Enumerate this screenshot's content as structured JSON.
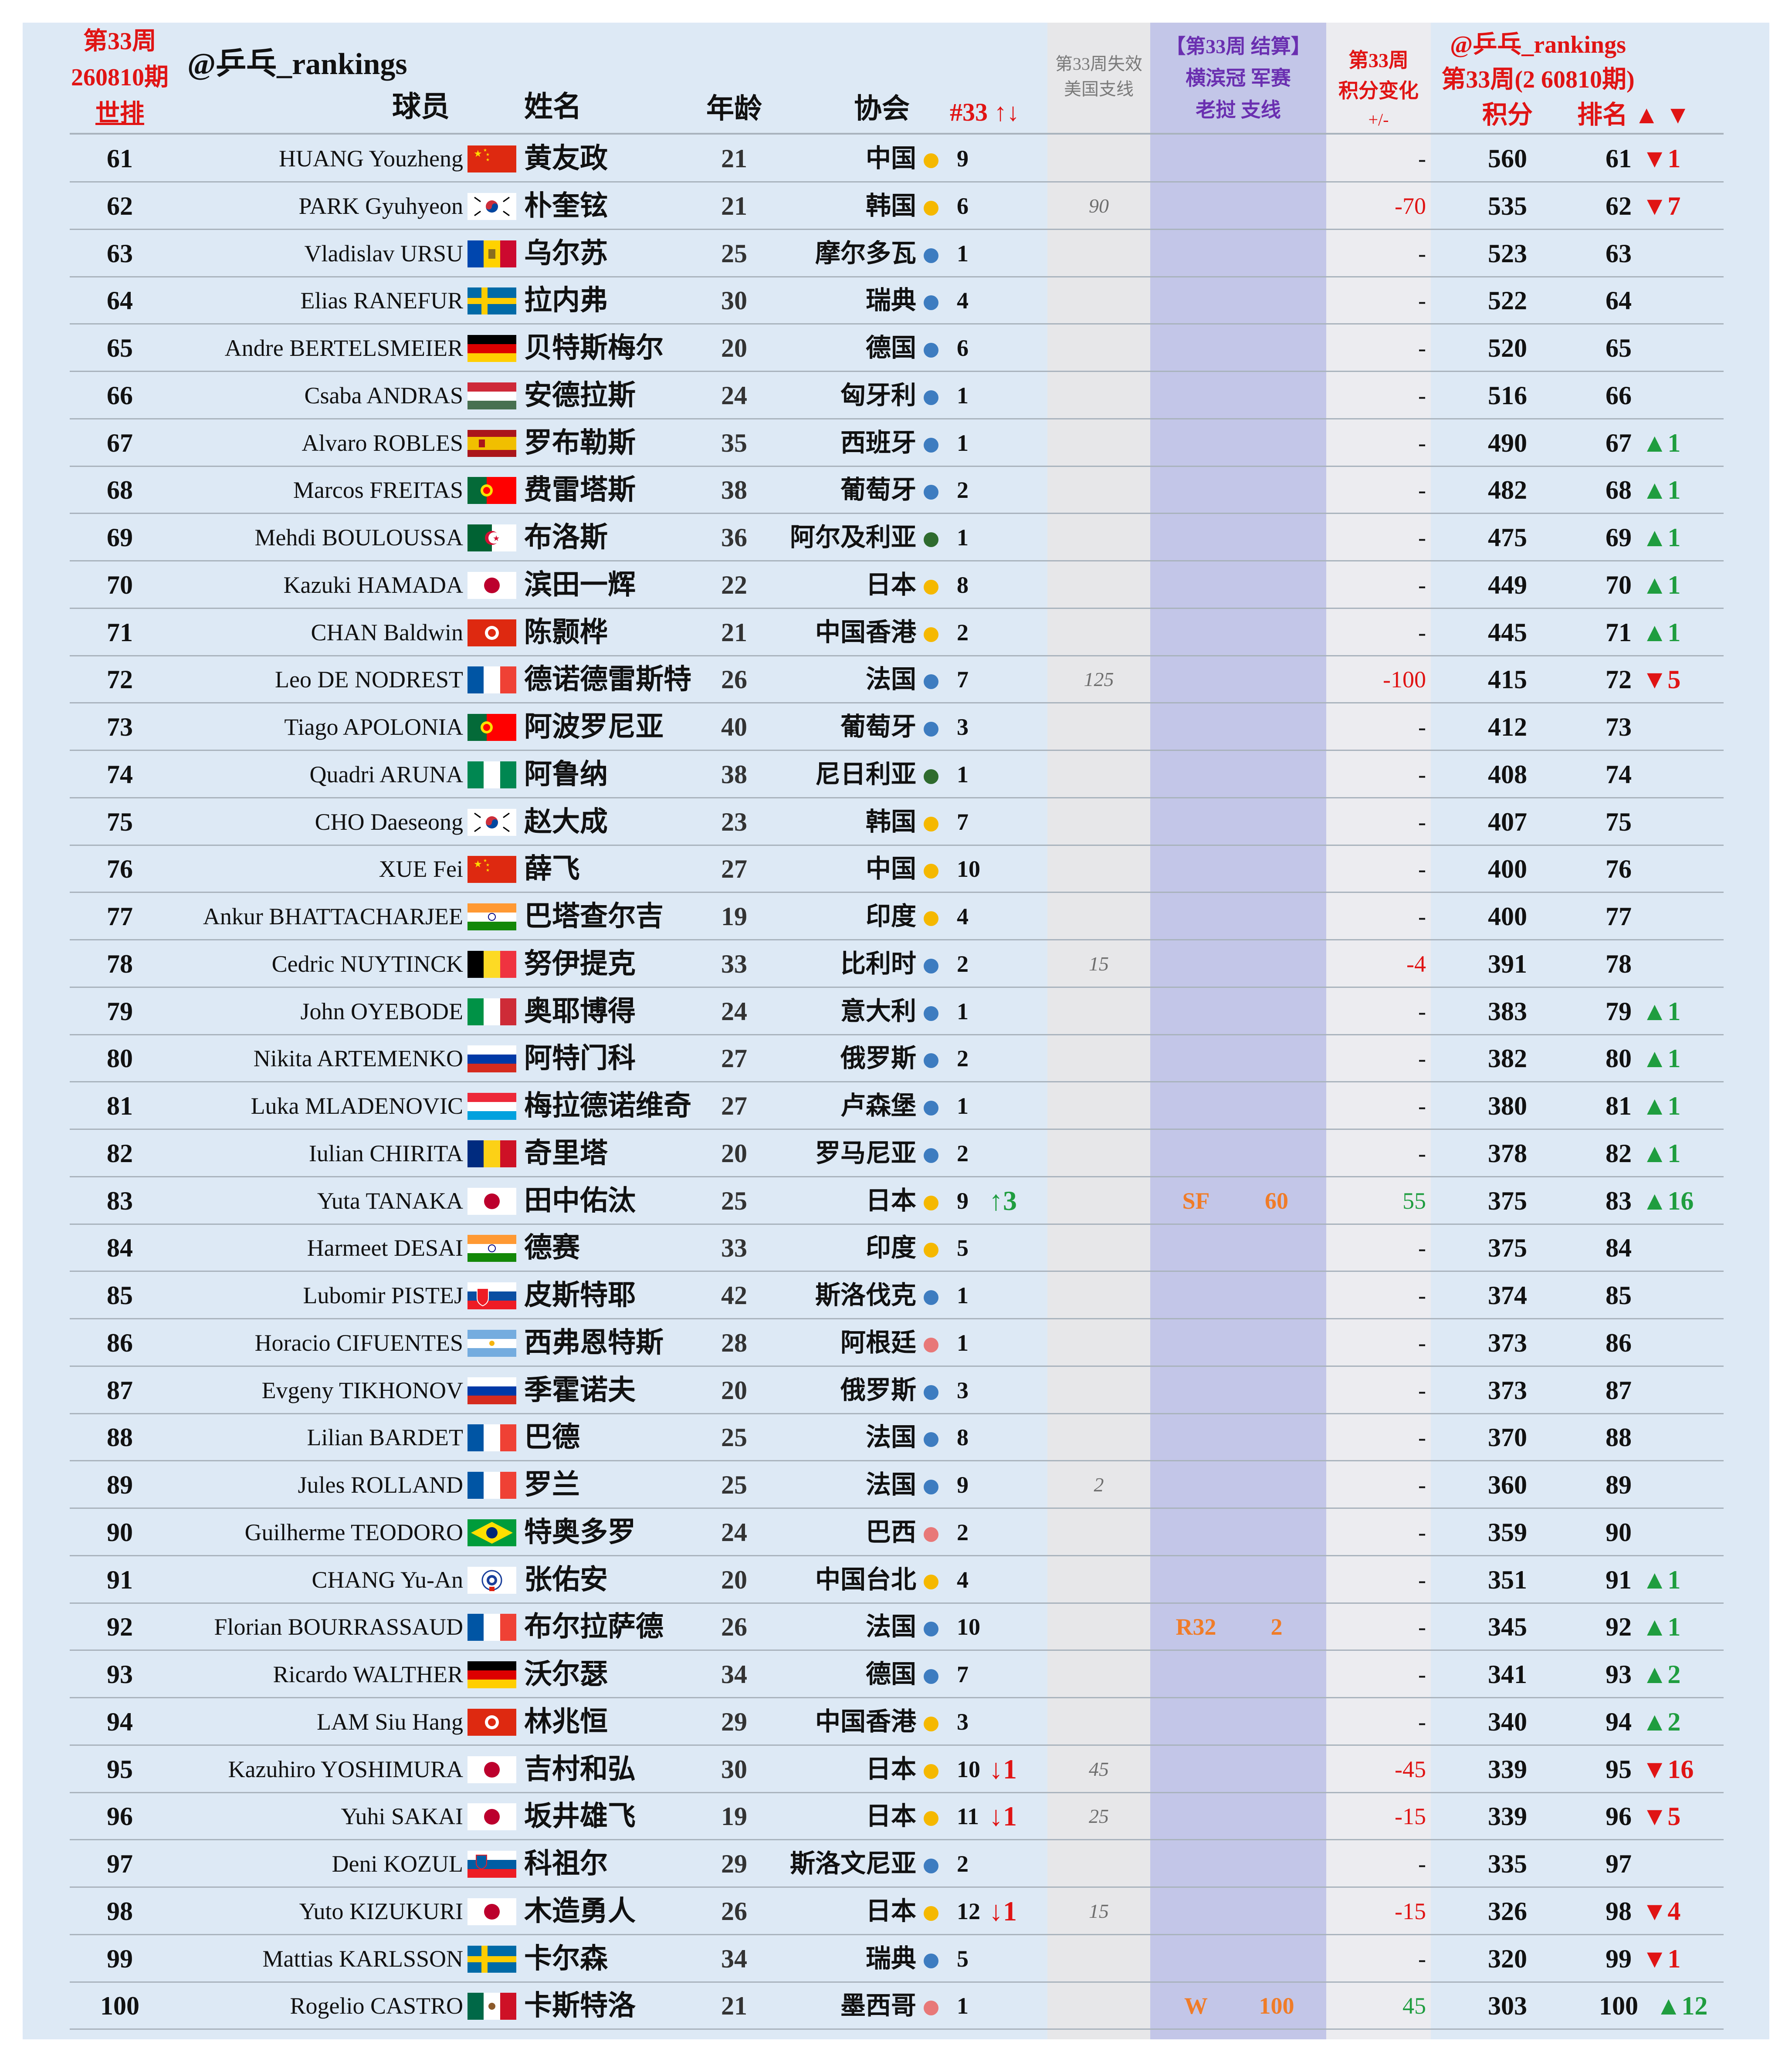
{
  "header": {
    "week_label": "第33周",
    "issue": "260810期",
    "world_rank_label": "世排",
    "brand": "@乒乓_rankings",
    "col_player": "球员",
    "col_name": "姓名",
    "col_age": "年龄",
    "col_assoc": "协会",
    "col_week_move": "#33 ↑↓",
    "loss_title_1": "第33周失效",
    "loss_title_2": "美国支线",
    "event_title_1": "【第33周 结算】",
    "event_title_2": "横滨冠 军赛",
    "event_title_3": "老挝 支线",
    "change_title_1": "第33周",
    "change_title_2": "积分变化",
    "change_title_3": "+/-",
    "brand_right": "@乒乓_rankings",
    "issue_right": "第33周(2 60810期)",
    "col_points": "积分",
    "col_rank": "排名 ▲ ▼"
  },
  "colors": {
    "frame_bg": "#dde9f5",
    "loss_band": "#e7e7e9",
    "event_band": "#c3c6e8",
    "title_red": "#e01414",
    "title_purple": "#6a2fb0",
    "up_green": "#1f9d3f",
    "down_red": "#e01414",
    "event_orange": "#f07c28",
    "dot_yellow": "#f5b800",
    "dot_blue": "#3d7cc0",
    "dot_green": "#2e6b2e",
    "dot_pink": "#e87878"
  },
  "rows": [
    {
      "rank": "61",
      "en": "HUANG Youzheng",
      "flag": "china",
      "cn": "黄友政",
      "age": "21",
      "assoc": "中国",
      "dot": "yellow",
      "count": "9",
      "move": "",
      "loss": "",
      "res": "",
      "epts": "",
      "chg": "-",
      "pts": "560",
      "new_rank": "61",
      "rmove": "▼1"
    },
    {
      "rank": "62",
      "en": "PARK Gyuhyeon",
      "flag": "korea",
      "cn": "朴奎铉",
      "age": "21",
      "assoc": "韩国",
      "dot": "yellow",
      "count": "6",
      "move": "",
      "loss": "90",
      "res": "",
      "epts": "",
      "chg": "-70",
      "pts": "535",
      "new_rank": "62",
      "rmove": "▼7"
    },
    {
      "rank": "63",
      "en": "Vladislav URSU",
      "flag": "moldova",
      "cn": "乌尔苏",
      "age": "25",
      "assoc": "摩尔多瓦",
      "dot": "blue",
      "count": "1",
      "move": "",
      "loss": "",
      "res": "",
      "epts": "",
      "chg": "-",
      "pts": "523",
      "new_rank": "63",
      "rmove": ""
    },
    {
      "rank": "64",
      "en": "Elias RANEFUR",
      "flag": "sweden",
      "cn": "拉内弗",
      "age": "30",
      "assoc": "瑞典",
      "dot": "blue",
      "count": "4",
      "move": "",
      "loss": "",
      "res": "",
      "epts": "",
      "chg": "-",
      "pts": "522",
      "new_rank": "64",
      "rmove": ""
    },
    {
      "rank": "65",
      "en": "Andre BERTELSMEIER",
      "flag": "germany",
      "cn": "贝特斯梅尔",
      "age": "20",
      "assoc": "德国",
      "dot": "blue",
      "count": "6",
      "move": "",
      "loss": "",
      "res": "",
      "epts": "",
      "chg": "-",
      "pts": "520",
      "new_rank": "65",
      "rmove": ""
    },
    {
      "rank": "66",
      "en": "Csaba ANDRAS",
      "flag": "hungary",
      "cn": "安德拉斯",
      "age": "24",
      "assoc": "匈牙利",
      "dot": "blue",
      "count": "1",
      "move": "",
      "loss": "",
      "res": "",
      "epts": "",
      "chg": "-",
      "pts": "516",
      "new_rank": "66",
      "rmove": ""
    },
    {
      "rank": "67",
      "en": "Alvaro ROBLES",
      "flag": "spain",
      "cn": "罗布勒斯",
      "age": "35",
      "assoc": "西班牙",
      "dot": "blue",
      "count": "1",
      "move": "",
      "loss": "",
      "res": "",
      "epts": "",
      "chg": "-",
      "pts": "490",
      "new_rank": "67",
      "rmove": "▲1"
    },
    {
      "rank": "68",
      "en": "Marcos FREITAS",
      "flag": "portugal",
      "cn": "费雷塔斯",
      "age": "38",
      "assoc": "葡萄牙",
      "dot": "blue",
      "count": "2",
      "move": "",
      "loss": "",
      "res": "",
      "epts": "",
      "chg": "-",
      "pts": "482",
      "new_rank": "68",
      "rmove": "▲1"
    },
    {
      "rank": "69",
      "en": "Mehdi BOULOUSSA",
      "flag": "algeria",
      "cn": "布洛斯",
      "age": "36",
      "assoc": "阿尔及利亚",
      "dot": "green",
      "count": "1",
      "move": "",
      "loss": "",
      "res": "",
      "epts": "",
      "chg": "-",
      "pts": "475",
      "new_rank": "69",
      "rmove": "▲1"
    },
    {
      "rank": "70",
      "en": "Kazuki HAMADA",
      "flag": "japan",
      "cn": "滨田一辉",
      "age": "22",
      "assoc": "日本",
      "dot": "yellow",
      "count": "8",
      "move": "",
      "loss": "",
      "res": "",
      "epts": "",
      "chg": "-",
      "pts": "449",
      "new_rank": "70",
      "rmove": "▲1"
    },
    {
      "rank": "71",
      "en": "CHAN Baldwin",
      "flag": "hongkong",
      "cn": "陈颢桦",
      "age": "21",
      "assoc": "中国香港",
      "dot": "yellow",
      "count": "2",
      "move": "",
      "loss": "",
      "res": "",
      "epts": "",
      "chg": "-",
      "pts": "445",
      "new_rank": "71",
      "rmove": "▲1"
    },
    {
      "rank": "72",
      "en": "Leo DE NODREST",
      "flag": "france",
      "cn": "德诺德雷斯特",
      "age": "26",
      "assoc": "法国",
      "dot": "blue",
      "count": "7",
      "move": "",
      "loss": "125",
      "res": "",
      "epts": "",
      "chg": "-100",
      "pts": "415",
      "new_rank": "72",
      "rmove": "▼5"
    },
    {
      "rank": "73",
      "en": "Tiago APOLONIA",
      "flag": "portugal",
      "cn": "阿波罗尼亚",
      "age": "40",
      "assoc": "葡萄牙",
      "dot": "blue",
      "count": "3",
      "move": "",
      "loss": "",
      "res": "",
      "epts": "",
      "chg": "-",
      "pts": "412",
      "new_rank": "73",
      "rmove": ""
    },
    {
      "rank": "74",
      "en": "Quadri ARUNA",
      "flag": "nigeria",
      "cn": "阿鲁纳",
      "age": "38",
      "assoc": "尼日利亚",
      "dot": "green",
      "count": "1",
      "move": "",
      "loss": "",
      "res": "",
      "epts": "",
      "chg": "-",
      "pts": "408",
      "new_rank": "74",
      "rmove": ""
    },
    {
      "rank": "75",
      "en": "CHO Daeseong",
      "flag": "korea",
      "cn": "赵大成",
      "age": "23",
      "assoc": "韩国",
      "dot": "yellow",
      "count": "7",
      "move": "",
      "loss": "",
      "res": "",
      "epts": "",
      "chg": "-",
      "pts": "407",
      "new_rank": "75",
      "rmove": ""
    },
    {
      "rank": "76",
      "en": "XUE Fei",
      "flag": "china",
      "cn": "薛飞",
      "age": "27",
      "assoc": "中国",
      "dot": "yellow",
      "count": "10",
      "move": "",
      "loss": "",
      "res": "",
      "epts": "",
      "chg": "-",
      "pts": "400",
      "new_rank": "76",
      "rmove": ""
    },
    {
      "rank": "77",
      "en": "Ankur BHATTACHARJEE",
      "flag": "india",
      "cn": "巴塔查尔吉",
      "age": "19",
      "assoc": "印度",
      "dot": "yellow",
      "count": "4",
      "move": "",
      "loss": "",
      "res": "",
      "epts": "",
      "chg": "-",
      "pts": "400",
      "new_rank": "77",
      "rmove": ""
    },
    {
      "rank": "78",
      "en": "Cedric NUYTINCK",
      "flag": "belgium",
      "cn": "努伊提克",
      "age": "33",
      "assoc": "比利时",
      "dot": "blue",
      "count": "2",
      "move": "",
      "loss": "15",
      "res": "",
      "epts": "",
      "chg": "-4",
      "pts": "391",
      "new_rank": "78",
      "rmove": ""
    },
    {
      "rank": "79",
      "en": "John OYEBODE",
      "flag": "italy",
      "cn": "奥耶博得",
      "age": "24",
      "assoc": "意大利",
      "dot": "blue",
      "count": "1",
      "move": "",
      "loss": "",
      "res": "",
      "epts": "",
      "chg": "-",
      "pts": "383",
      "new_rank": "79",
      "rmove": "▲1"
    },
    {
      "rank": "80",
      "en": "Nikita ARTEMENKO",
      "flag": "russia",
      "cn": "阿特门科",
      "age": "27",
      "assoc": "俄罗斯",
      "dot": "blue",
      "count": "2",
      "move": "",
      "loss": "",
      "res": "",
      "epts": "",
      "chg": "-",
      "pts": "382",
      "new_rank": "80",
      "rmove": "▲1"
    },
    {
      "rank": "81",
      "en": "Luka MLADENOVIC",
      "flag": "luxembourg",
      "cn": "梅拉德诺维奇",
      "age": "27",
      "assoc": "卢森堡",
      "dot": "blue",
      "count": "1",
      "move": "",
      "loss": "",
      "res": "",
      "epts": "",
      "chg": "-",
      "pts": "380",
      "new_rank": "81",
      "rmove": "▲1"
    },
    {
      "rank": "82",
      "en": "Iulian CHIRITA",
      "flag": "romania",
      "cn": "奇里塔",
      "age": "20",
      "assoc": "罗马尼亚",
      "dot": "blue",
      "count": "2",
      "move": "",
      "loss": "",
      "res": "",
      "epts": "",
      "chg": "-",
      "pts": "378",
      "new_rank": "82",
      "rmove": "▲1"
    },
    {
      "rank": "83",
      "en": "Yuta TANAKA",
      "flag": "japan",
      "cn": "田中佑汰",
      "age": "25",
      "assoc": "日本",
      "dot": "yellow",
      "count": "9",
      "move": "↑3",
      "loss": "",
      "res": "SF",
      "epts": "60",
      "chg": "55",
      "pts": "375",
      "new_rank": "83",
      "rmove": "▲16"
    },
    {
      "rank": "84",
      "en": "Harmeet DESAI",
      "flag": "india",
      "cn": "德赛",
      "age": "33",
      "assoc": "印度",
      "dot": "yellow",
      "count": "5",
      "move": "",
      "loss": "",
      "res": "",
      "epts": "",
      "chg": "-",
      "pts": "375",
      "new_rank": "84",
      "rmove": ""
    },
    {
      "rank": "85",
      "en": "Lubomir PISTEJ",
      "flag": "slovakia",
      "cn": "皮斯特耶",
      "age": "42",
      "assoc": "斯洛伐克",
      "dot": "blue",
      "count": "1",
      "move": "",
      "loss": "",
      "res": "",
      "epts": "",
      "chg": "-",
      "pts": "374",
      "new_rank": "85",
      "rmove": ""
    },
    {
      "rank": "86",
      "en": "Horacio CIFUENTES",
      "flag": "argentina",
      "cn": "西弗恩特斯",
      "age": "28",
      "assoc": "阿根廷",
      "dot": "pink",
      "count": "1",
      "move": "",
      "loss": "",
      "res": "",
      "epts": "",
      "chg": "-",
      "pts": "373",
      "new_rank": "86",
      "rmove": ""
    },
    {
      "rank": "87",
      "en": "Evgeny TIKHONOV",
      "flag": "russia",
      "cn": "季霍诺夫",
      "age": "20",
      "assoc": "俄罗斯",
      "dot": "blue",
      "count": "3",
      "move": "",
      "loss": "",
      "res": "",
      "epts": "",
      "chg": "-",
      "pts": "373",
      "new_rank": "87",
      "rmove": ""
    },
    {
      "rank": "88",
      "en": "Lilian BARDET",
      "flag": "france",
      "cn": "巴德",
      "age": "25",
      "assoc": "法国",
      "dot": "blue",
      "count": "8",
      "move": "",
      "loss": "",
      "res": "",
      "epts": "",
      "chg": "-",
      "pts": "370",
      "new_rank": "88",
      "rmove": ""
    },
    {
      "rank": "89",
      "en": "Jules ROLLAND",
      "flag": "france",
      "cn": "罗兰",
      "age": "25",
      "assoc": "法国",
      "dot": "blue",
      "count": "9",
      "move": "",
      "loss": "2",
      "res": "",
      "epts": "",
      "chg": "-",
      "pts": "360",
      "new_rank": "89",
      "rmove": ""
    },
    {
      "rank": "90",
      "en": "Guilherme TEODORO",
      "flag": "brazil",
      "cn": "特奥多罗",
      "age": "24",
      "assoc": "巴西",
      "dot": "pink",
      "count": "2",
      "move": "",
      "loss": "",
      "res": "",
      "epts": "",
      "chg": "-",
      "pts": "359",
      "new_rank": "90",
      "rmove": ""
    },
    {
      "rank": "91",
      "en": "CHANG Yu-An",
      "flag": "taipei",
      "cn": "张佑安",
      "age": "20",
      "assoc": "中国台北",
      "dot": "yellow",
      "count": "4",
      "move": "",
      "loss": "",
      "res": "",
      "epts": "",
      "chg": "-",
      "pts": "351",
      "new_rank": "91",
      "rmove": "▲1"
    },
    {
      "rank": "92",
      "en": "Florian BOURRASSAUD",
      "flag": "france",
      "cn": "布尔拉萨德",
      "age": "26",
      "assoc": "法国",
      "dot": "blue",
      "count": "10",
      "move": "",
      "loss": "",
      "res": "R32",
      "epts": "2",
      "chg": "-",
      "pts": "345",
      "new_rank": "92",
      "rmove": "▲1"
    },
    {
      "rank": "93",
      "en": "Ricardo WALTHER",
      "flag": "germany",
      "cn": "沃尔瑟",
      "age": "34",
      "assoc": "德国",
      "dot": "blue",
      "count": "7",
      "move": "",
      "loss": "",
      "res": "",
      "epts": "",
      "chg": "-",
      "pts": "341",
      "new_rank": "93",
      "rmove": "▲2"
    },
    {
      "rank": "94",
      "en": "LAM Siu Hang",
      "flag": "hongkong",
      "cn": "林兆恒",
      "age": "29",
      "assoc": "中国香港",
      "dot": "yellow",
      "count": "3",
      "move": "",
      "loss": "",
      "res": "",
      "epts": "",
      "chg": "-",
      "pts": "340",
      "new_rank": "94",
      "rmove": "▲2"
    },
    {
      "rank": "95",
      "en": "Kazuhiro YOSHIMURA",
      "flag": "japan",
      "cn": "吉村和弘",
      "age": "30",
      "assoc": "日本",
      "dot": "yellow",
      "count": "10",
      "move": "↓1",
      "loss": "45",
      "res": "",
      "epts": "",
      "chg": "-45",
      "pts": "339",
      "new_rank": "95",
      "rmove": "▼16"
    },
    {
      "rank": "96",
      "en": "Yuhi SAKAI",
      "flag": "japan",
      "cn": "坂井雄飞",
      "age": "19",
      "assoc": "日本",
      "dot": "yellow",
      "count": "11",
      "move": "↓1",
      "loss": "25",
      "res": "",
      "epts": "",
      "chg": "-15",
      "pts": "339",
      "new_rank": "96",
      "rmove": "▼5"
    },
    {
      "rank": "97",
      "en": "Deni KOZUL",
      "flag": "slovenia",
      "cn": "科祖尔",
      "age": "29",
      "assoc": "斯洛文尼亚",
      "dot": "blue",
      "count": "2",
      "move": "",
      "loss": "",
      "res": "",
      "epts": "",
      "chg": "-",
      "pts": "335",
      "new_rank": "97",
      "rmove": ""
    },
    {
      "rank": "98",
      "en": "Yuto KIZUKURI",
      "flag": "japan",
      "cn": "木造勇人",
      "age": "26",
      "assoc": "日本",
      "dot": "yellow",
      "count": "12",
      "move": "↓1",
      "loss": "15",
      "res": "",
      "epts": "",
      "chg": "-15",
      "pts": "326",
      "new_rank": "98",
      "rmove": "▼4"
    },
    {
      "rank": "99",
      "en": "Mattias KARLSSON",
      "flag": "sweden",
      "cn": "卡尔森",
      "age": "34",
      "assoc": "瑞典",
      "dot": "blue",
      "count": "5",
      "move": "",
      "loss": "",
      "res": "",
      "epts": "",
      "chg": "-",
      "pts": "320",
      "new_rank": "99",
      "rmove": "▼1"
    },
    {
      "rank": "100",
      "en": "Rogelio CASTRO",
      "flag": "mexico",
      "cn": "卡斯特洛",
      "age": "21",
      "assoc": "墨西哥",
      "dot": "pink",
      "count": "1",
      "move": "",
      "loss": "",
      "res": "W",
      "epts": "100",
      "chg": "45",
      "pts": "303",
      "new_rank": "100",
      "rmove": "▲12"
    }
  ]
}
